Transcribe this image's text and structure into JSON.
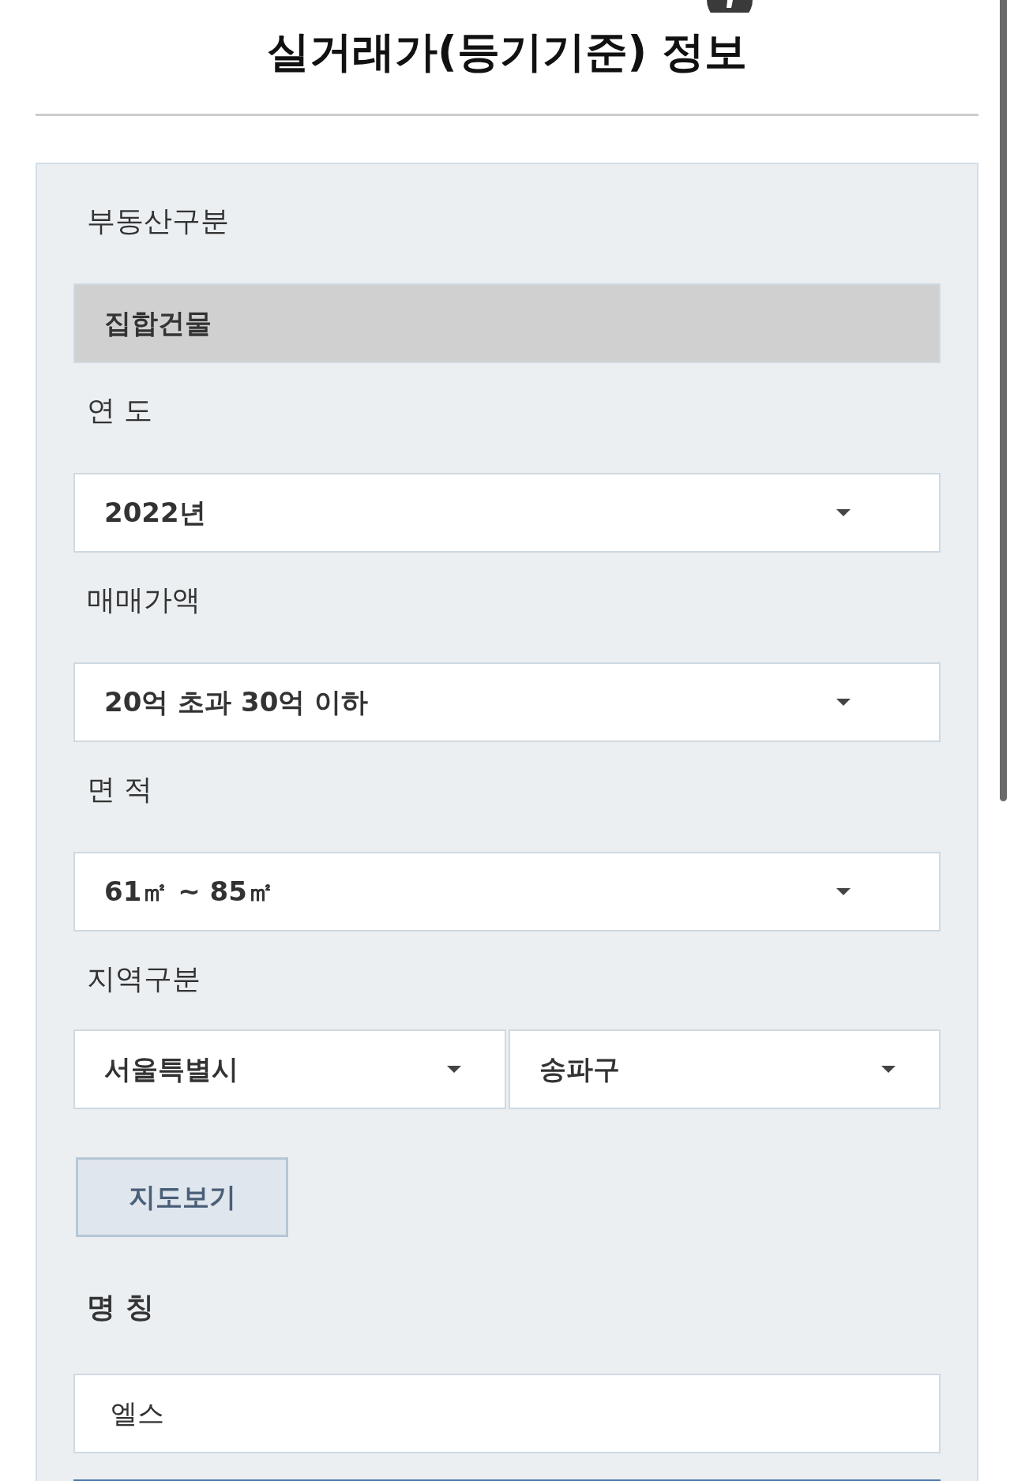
{
  "header": {
    "title": "실거래가(등기기준) 정보"
  },
  "form": {
    "fields": [
      {
        "kind": "choice",
        "label": "부동산구분",
        "value": "집합건물",
        "disabled": true
      },
      {
        "kind": "select",
        "label": "연 도",
        "value": "2022년",
        "disabled": false
      },
      {
        "kind": "select",
        "label": "매매가액",
        "value": "20억 초과 30억 이하",
        "disabled": false
      },
      {
        "kind": "select",
        "label": "면 적",
        "value": "61㎡ ~ 85㎡",
        "disabled": false
      },
      {
        "kind": "select_pair",
        "label": "지역구분",
        "values": [
          "서울특별시",
          "송파구"
        ],
        "disabled": false
      },
      {
        "kind": "button",
        "label": "지도보기",
        "disabled": false
      },
      {
        "kind": "text",
        "label": "명 칭",
        "value": "엘스",
        "disabled": false
      }
    ]
  }
}
